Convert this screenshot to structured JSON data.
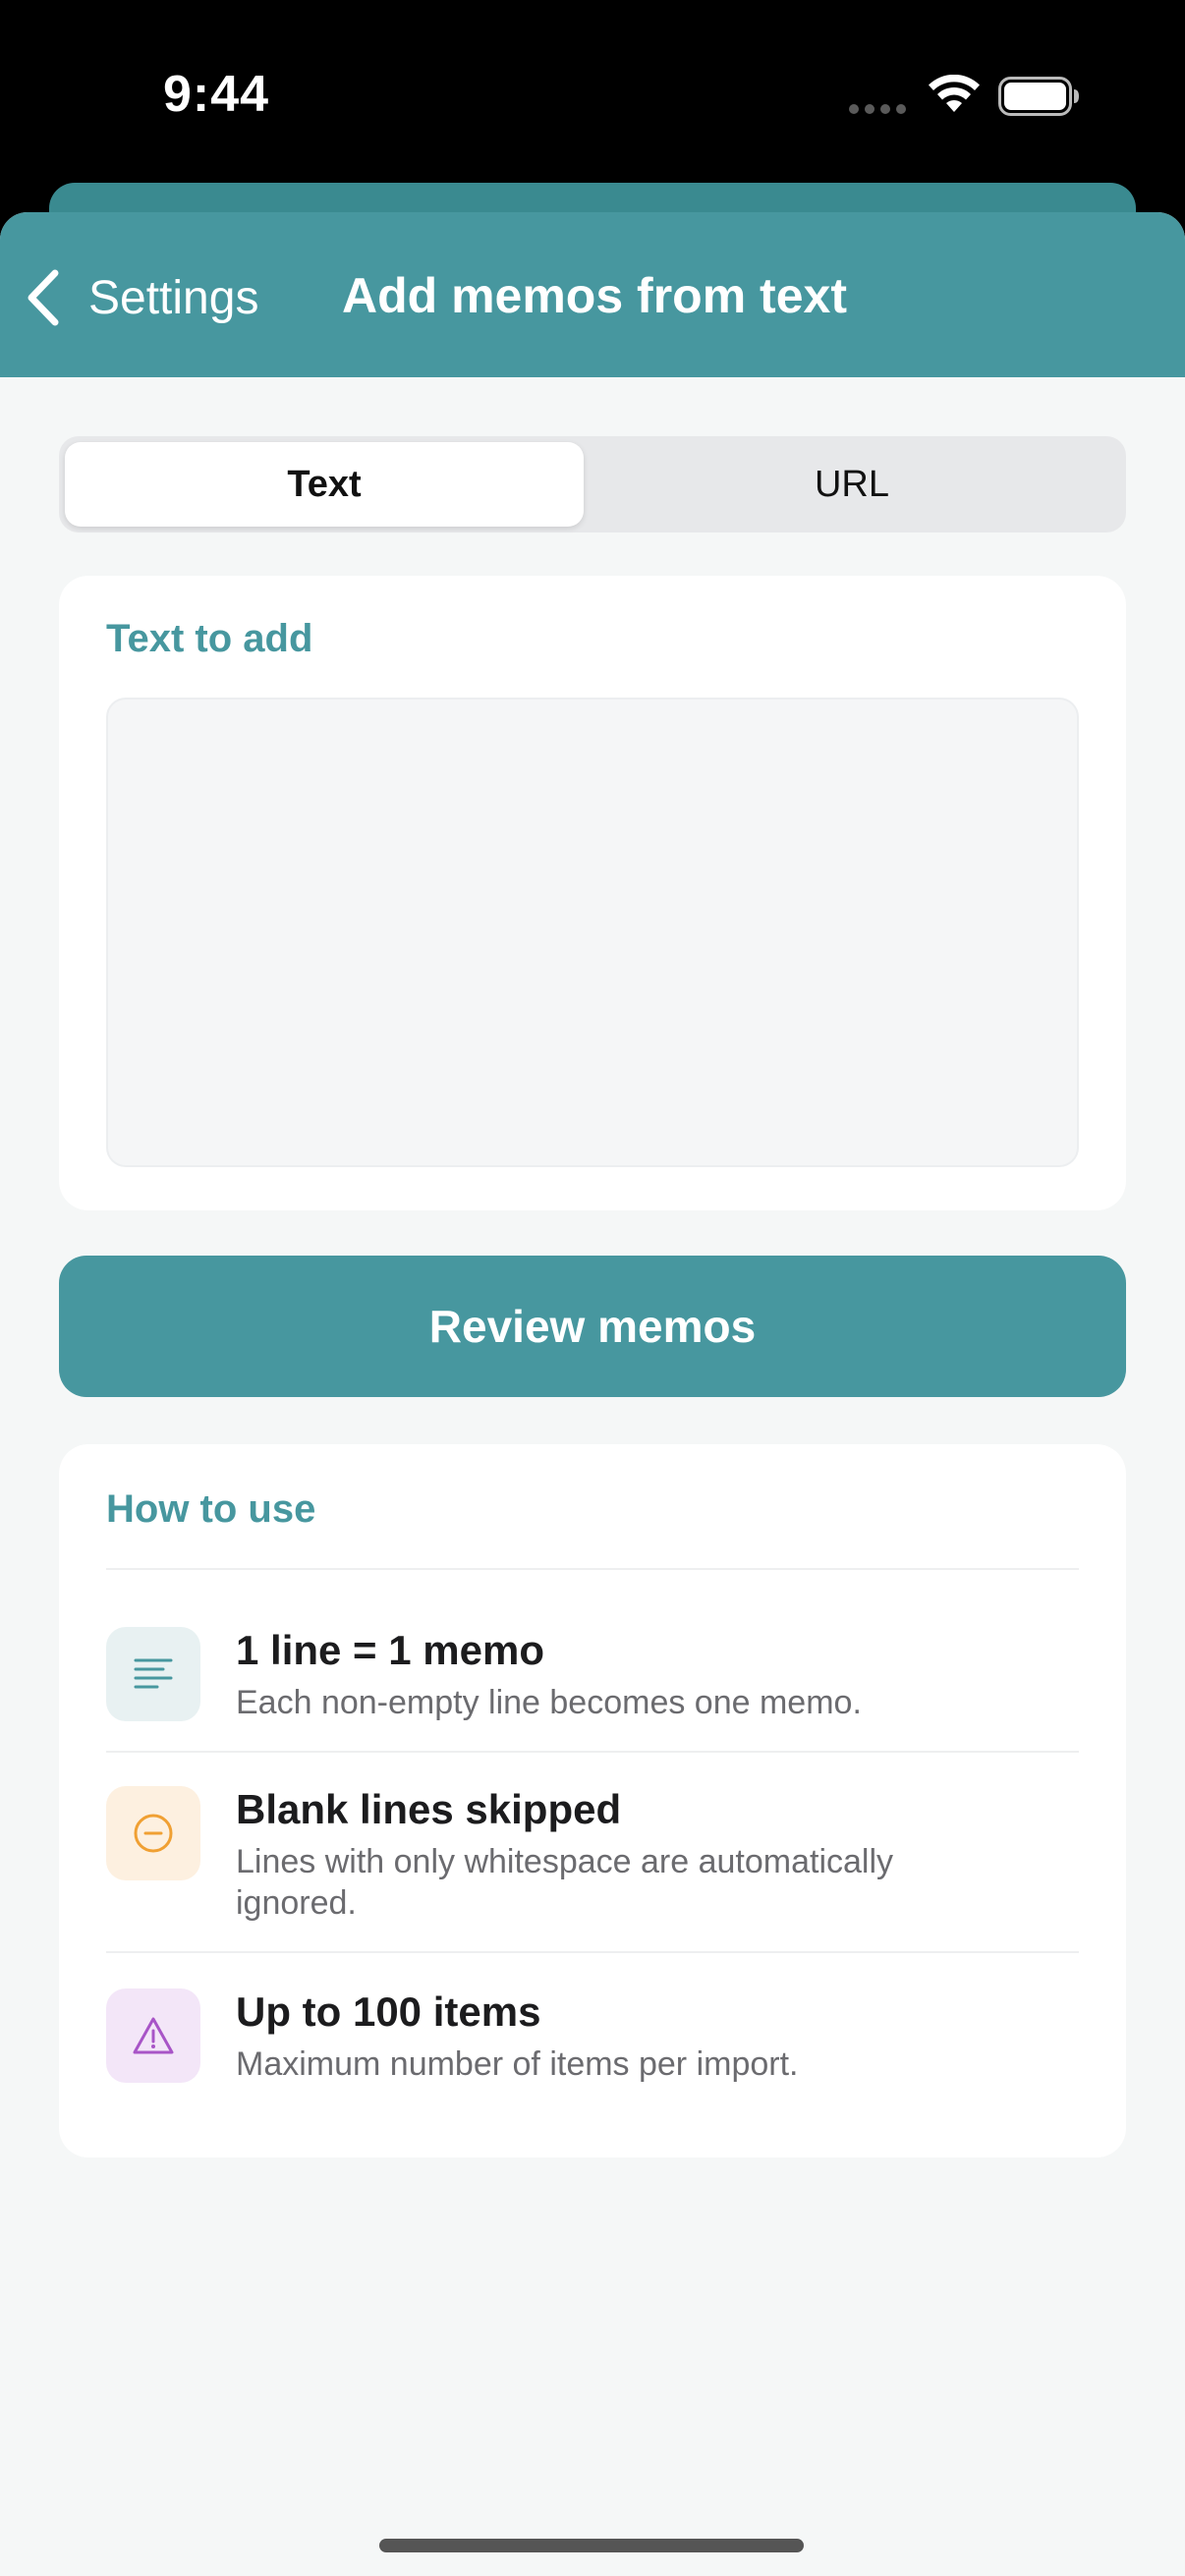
{
  "status_bar": {
    "time": "9:44"
  },
  "nav": {
    "back_label": "Settings",
    "title": "Add memos from text"
  },
  "segmented": {
    "options": [
      "Text",
      "URL"
    ],
    "selected": "Text"
  },
  "input_card": {
    "label": "Text to add",
    "value": "",
    "placeholder": ""
  },
  "review_button": {
    "label": "Review memos"
  },
  "how_to": {
    "title": "How to use",
    "items": [
      {
        "icon": "lines-icon",
        "title": "1 line = 1 memo",
        "desc": "Each non-empty line becomes one memo.",
        "icon_color": "#47979f",
        "icon_bg": "#e8f1f2"
      },
      {
        "icon": "minus-circle-icon",
        "title": "Blank lines skipped",
        "desc": "Lines with only whitespace are automatically ignored.",
        "icon_color": "#f0a033",
        "icon_bg": "#fdf0e0"
      },
      {
        "icon": "warning-icon",
        "title": "Up to 100 items",
        "desc": "Maximum number of items per import.",
        "icon_color": "#a855c7",
        "icon_bg": "#f3e6f8"
      }
    ]
  },
  "colors": {
    "accent": "#47979f",
    "background": "#f5f7f7"
  }
}
